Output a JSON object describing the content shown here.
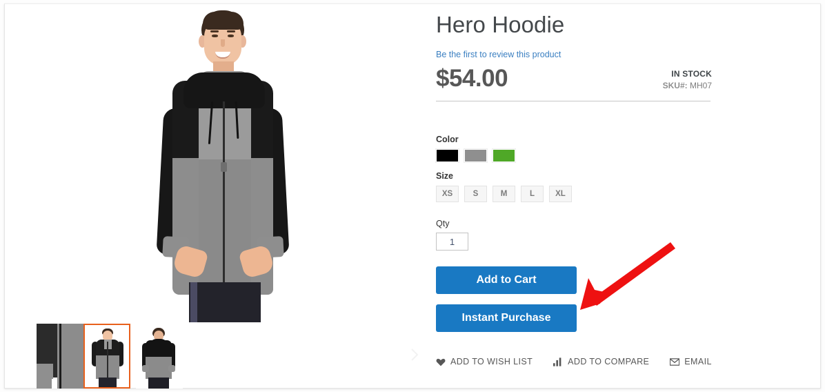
{
  "product": {
    "title": "Hero Hoodie",
    "review_link": "Be the first to review this product",
    "price": "$54.00",
    "stock_status": "IN STOCK",
    "sku_label": "SKU#:",
    "sku_value": "MH07"
  },
  "options": {
    "color": {
      "label": "Color",
      "swatches": [
        {
          "name": "black",
          "hex": "#000000"
        },
        {
          "name": "gray",
          "hex": "#8f8f8f"
        },
        {
          "name": "green",
          "hex": "#4fa827"
        }
      ]
    },
    "size": {
      "label": "Size",
      "values": [
        "XS",
        "S",
        "M",
        "L",
        "XL"
      ]
    },
    "qty": {
      "label": "Qty",
      "value": "1",
      "placeholder": "1"
    }
  },
  "actions": {
    "add_to_cart": "Add to Cart",
    "instant_purchase": "Instant Purchase",
    "accent_color": "#1979c3"
  },
  "links": [
    {
      "icon": "heart-icon",
      "label": "ADD TO WISH LIST"
    },
    {
      "icon": "compare-bars-icon",
      "label": "ADD TO COMPARE"
    },
    {
      "icon": "envelope-icon",
      "label": "EMAIL"
    }
  ],
  "gallery": {
    "next_icon": "chevron-right-icon",
    "thumbnails": [
      {
        "name": "thumbnail-1",
        "selected": false
      },
      {
        "name": "thumbnail-2",
        "selected": true
      },
      {
        "name": "thumbnail-3",
        "selected": false
      }
    ],
    "selected_border_color": "#e8601c"
  },
  "annotation": {
    "arrow_color": "#ee1111",
    "points_at": "Instant Purchase"
  }
}
